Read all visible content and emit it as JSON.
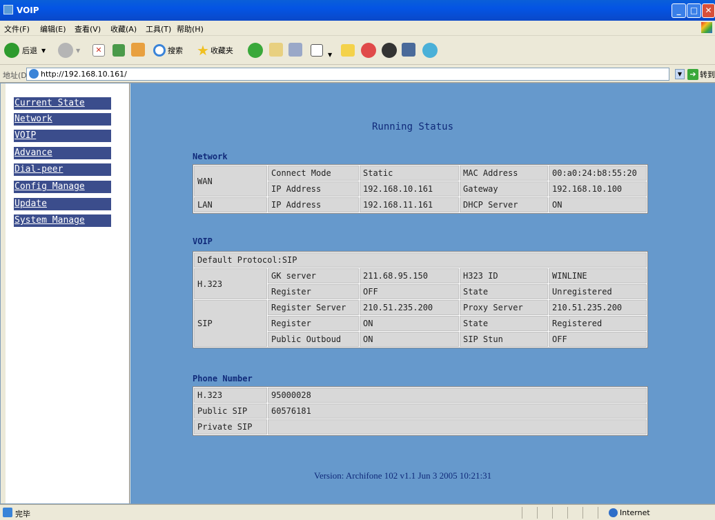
{
  "window": {
    "title": "VOIP"
  },
  "menu": [
    "文件(F)",
    "编辑(E)",
    "查看(V)",
    "收藏(A)",
    "工具(T)",
    "帮助(H)"
  ],
  "toolbar": {
    "back_label": "后退",
    "search_label": "搜索",
    "favorites_label": "收藏夹"
  },
  "address": {
    "label": "地址(D)",
    "url": "http://192.168.10.161/",
    "go_label": "转到"
  },
  "nav": {
    "items": [
      "Current State",
      "Network",
      "VOIP",
      "Advance",
      "Dial-peer",
      "Config Manage",
      "Update",
      "System Manage"
    ]
  },
  "page": {
    "title": "Running Status",
    "network": {
      "heading": "Network",
      "wan_label": "WAN",
      "lan_label": "LAN",
      "rows": [
        [
          "Connect Mode",
          "Static",
          "MAC Address",
          "00:a0:24:b8:55:20"
        ],
        [
          "IP Address",
          "192.168.10.161",
          "Gateway",
          "192.168.10.100"
        ],
        [
          "IP Address",
          "192.168.11.161",
          "DHCP Server",
          "ON"
        ]
      ]
    },
    "voip": {
      "heading": "VOIP",
      "default_protocol": "Default Protocol:SIP",
      "h323_label": "H.323",
      "sip_label": "SIP",
      "h323_rows": [
        [
          "GK server",
          "211.68.95.150",
          "H323 ID",
          "WINLINE"
        ],
        [
          "Register",
          "OFF",
          "State",
          "Unregistered"
        ]
      ],
      "sip_rows": [
        [
          "Register Server",
          "210.51.235.200",
          "Proxy Server",
          "210.51.235.200"
        ],
        [
          "Register",
          "ON",
          "State",
          "Registered"
        ],
        [
          "Public Outboud",
          "ON",
          "SIP Stun",
          "OFF"
        ]
      ]
    },
    "phone": {
      "heading": "Phone Number",
      "rows": [
        [
          "H.323",
          "95000028"
        ],
        [
          "Public SIP",
          "60576181"
        ],
        [
          "Private SIP",
          ""
        ]
      ]
    },
    "version": "Version: Archifone 102 v1.1 Jun 3 2005 10:21:31"
  },
  "status": {
    "text": "完毕",
    "zone": "Internet"
  },
  "colors": {
    "nav_bg": "#3b4d8c",
    "main_bg": "#6699cc",
    "heading": "#102a7a"
  }
}
